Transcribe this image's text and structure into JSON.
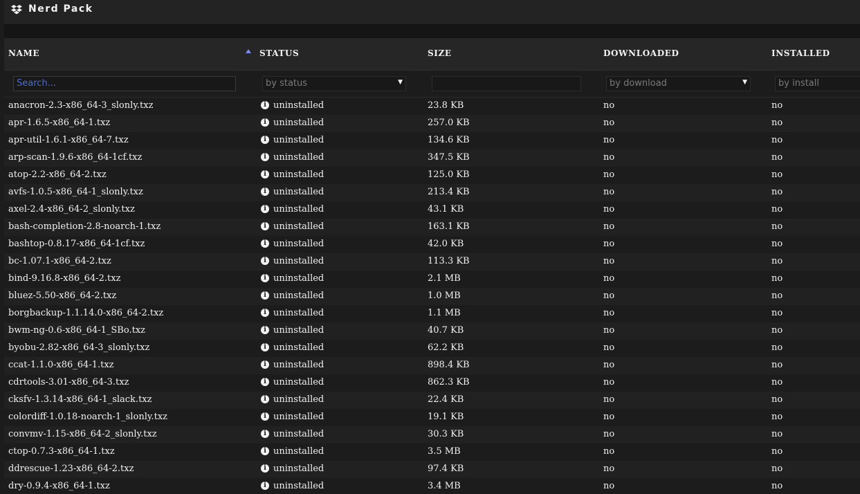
{
  "plugin": {
    "title": "Nerd Pack",
    "icon": "dropbox-icon"
  },
  "table": {
    "headers": {
      "name": "NAME",
      "status": "STATUS",
      "size": "SIZE",
      "downloaded": "DOWNLOADED",
      "installed": "INSTALLED"
    },
    "sort": {
      "column": "name",
      "direction": "ascending",
      "icon": "sort-ascending-icon"
    },
    "filters": {
      "name_placeholder": "Search...",
      "status_value": "by status",
      "size_value": "",
      "downloaded_value": "by download",
      "installed_value": "by install"
    },
    "status_icon": "info-circle-icon",
    "rows": [
      {
        "name": "anacron-2.3-x86_64-3_slonly.txz",
        "status": "uninstalled",
        "size": "23.8 KB",
        "downloaded": "no",
        "installed": "no"
      },
      {
        "name": "apr-1.6.5-x86_64-1.txz",
        "status": "uninstalled",
        "size": "257.0 KB",
        "downloaded": "no",
        "installed": "no"
      },
      {
        "name": "apr-util-1.6.1-x86_64-7.txz",
        "status": "uninstalled",
        "size": "134.6 KB",
        "downloaded": "no",
        "installed": "no"
      },
      {
        "name": "arp-scan-1.9.6-x86_64-1cf.txz",
        "status": "uninstalled",
        "size": "347.5 KB",
        "downloaded": "no",
        "installed": "no"
      },
      {
        "name": "atop-2.2-x86_64-2.txz",
        "status": "uninstalled",
        "size": "125.0 KB",
        "downloaded": "no",
        "installed": "no"
      },
      {
        "name": "avfs-1.0.5-x86_64-1_slonly.txz",
        "status": "uninstalled",
        "size": "213.4 KB",
        "downloaded": "no",
        "installed": "no"
      },
      {
        "name": "axel-2.4-x86_64-2_slonly.txz",
        "status": "uninstalled",
        "size": "43.1 KB",
        "downloaded": "no",
        "installed": "no"
      },
      {
        "name": "bash-completion-2.8-noarch-1.txz",
        "status": "uninstalled",
        "size": "163.1 KB",
        "downloaded": "no",
        "installed": "no"
      },
      {
        "name": "bashtop-0.8.17-x86_64-1cf.txz",
        "status": "uninstalled",
        "size": "42.0 KB",
        "downloaded": "no",
        "installed": "no"
      },
      {
        "name": "bc-1.07.1-x86_64-2.txz",
        "status": "uninstalled",
        "size": "113.3 KB",
        "downloaded": "no",
        "installed": "no"
      },
      {
        "name": "bind-9.16.8-x86_64-2.txz",
        "status": "uninstalled",
        "size": "2.1 MB",
        "downloaded": "no",
        "installed": "no"
      },
      {
        "name": "bluez-5.50-x86_64-2.txz",
        "status": "uninstalled",
        "size": "1.0 MB",
        "downloaded": "no",
        "installed": "no"
      },
      {
        "name": "borgbackup-1.1.14.0-x86_64-2.txz",
        "status": "uninstalled",
        "size": "1.1 MB",
        "downloaded": "no",
        "installed": "no"
      },
      {
        "name": "bwm-ng-0.6-x86_64-1_SBo.txz",
        "status": "uninstalled",
        "size": "40.7 KB",
        "downloaded": "no",
        "installed": "no"
      },
      {
        "name": "byobu-2.82-x86_64-3_slonly.txz",
        "status": "uninstalled",
        "size": "62.2 KB",
        "downloaded": "no",
        "installed": "no"
      },
      {
        "name": "ccat-1.1.0-x86_64-1.txz",
        "status": "uninstalled",
        "size": "898.4 KB",
        "downloaded": "no",
        "installed": "no"
      },
      {
        "name": "cdrtools-3.01-x86_64-3.txz",
        "status": "uninstalled",
        "size": "862.3 KB",
        "downloaded": "no",
        "installed": "no"
      },
      {
        "name": "cksfv-1.3.14-x86_64-1_slack.txz",
        "status": "uninstalled",
        "size": "22.4 KB",
        "downloaded": "no",
        "installed": "no"
      },
      {
        "name": "colordiff-1.0.18-noarch-1_slonly.txz",
        "status": "uninstalled",
        "size": "19.1 KB",
        "downloaded": "no",
        "installed": "no"
      },
      {
        "name": "convmv-1.15-x86_64-2_slonly.txz",
        "status": "uninstalled",
        "size": "30.3 KB",
        "downloaded": "no",
        "installed": "no"
      },
      {
        "name": "ctop-0.7.3-x86_64-1.txz",
        "status": "uninstalled",
        "size": "3.5 MB",
        "downloaded": "no",
        "installed": "no"
      },
      {
        "name": "ddrescue-1.23-x86_64-2.txz",
        "status": "uninstalled",
        "size": "97.4 KB",
        "downloaded": "no",
        "installed": "no"
      },
      {
        "name": "dry-0.9.4-x86_64-1.txz",
        "status": "uninstalled",
        "size": "3.4 MB",
        "downloaded": "no",
        "installed": "no"
      }
    ]
  }
}
